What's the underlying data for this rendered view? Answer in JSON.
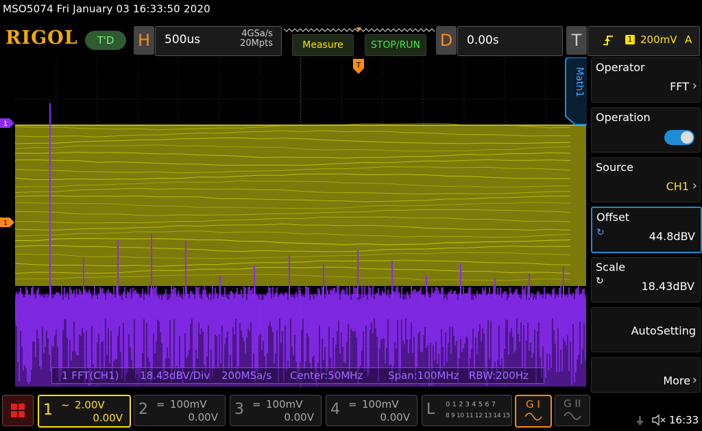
{
  "title_line": "MSO5074  Fri January 03 16:33:50 2020",
  "header": {
    "logo": "RIGOL",
    "td_badge": "T'D",
    "h_letter": "H",
    "timebase": "500us",
    "sample_rate": "4GSa/s",
    "memory_depth": "20Mpts",
    "measure_label": "Measure",
    "stoprun_label": "STOP/RUN",
    "d_letter": "D",
    "delay": "0.00s",
    "t_letter": "T",
    "trigger_channel": "1",
    "trigger_level": "200mV",
    "trigger_mode": "A"
  },
  "markers": {
    "trigger_pos": "T",
    "math_marker": "1",
    "ch1_marker": "1"
  },
  "fft_info": {
    "label": "1 FFT(CH1)",
    "scale": "18.43dBV/Div",
    "rate": "200MSa/s",
    "center": "Center:50MHz",
    "span": "Span:100MHz",
    "rbw": "RBW:200Hz"
  },
  "menu": {
    "tab_label": "Math1",
    "items": [
      {
        "label": "Operator",
        "value": "FFT"
      },
      {
        "label": "Operation",
        "value": ""
      },
      {
        "label": "Source",
        "value": "CH1"
      },
      {
        "label": "Offset",
        "value": "44.8dBV"
      },
      {
        "label": "Scale",
        "value": "18.43dBV"
      },
      {
        "label": "AutoSetting",
        "value": ""
      },
      {
        "label": "More",
        "value": ""
      }
    ]
  },
  "channels": [
    {
      "num": "1",
      "scale": "2.00V",
      "offset": "0.00V",
      "coupling": "~"
    },
    {
      "num": "2",
      "scale": "100mV",
      "offset": "0.00V",
      "coupling": "="
    },
    {
      "num": "3",
      "scale": "100mV",
      "offset": "0.00V",
      "coupling": "="
    },
    {
      "num": "4",
      "scale": "100mV",
      "offset": "0.00V",
      "coupling": "="
    }
  ],
  "logic": {
    "letter": "L",
    "row1": "0 1 2 3  4 5 6 7",
    "row2": "8 9 10 11 12 13 14 15"
  },
  "gen1": "G I",
  "gen2": "G II",
  "clock": "16:33",
  "colors": {
    "ch1": "#e6e600",
    "math": "#8b2cf5",
    "accent": "#1b8ed6",
    "orange": "#ff8a16"
  }
}
